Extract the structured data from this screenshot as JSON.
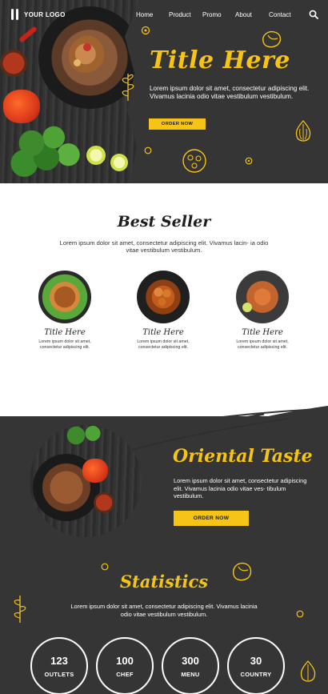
{
  "nav": {
    "logo_text": "YOUR LOGO",
    "items": [
      "Home",
      "Product",
      "Promo",
      "About",
      "Contact"
    ],
    "search_icon": "search-icon"
  },
  "hero": {
    "title": "Title Here",
    "body": "Lorem ipsum dolor sit amet, consectetur adipiscing elit. Vivamus lacinia odio vitae vestibulum vestibulum.",
    "button": "ORDER NOW"
  },
  "best_seller": {
    "title": "Best Seller",
    "body": "Lorem ipsum dolor sit amet, consectetur adipiscing elit. Vivamus lacin- ia odio vitae vestibulum vestibulum.",
    "dishes": [
      {
        "name": "Title Here",
        "desc": "Lorem ipsum dolor sit amet, consectetur adipiscing elit."
      },
      {
        "name": "Title Here",
        "desc": "Lorem ipsum dolor sit amet, consectetur adipiscing elit."
      },
      {
        "name": "Title Here",
        "desc": "Lorem ipsum dolor sit amet, consectetur adipiscing elit."
      }
    ]
  },
  "oriental": {
    "title": "Oriental Taste",
    "body": "Lorem ipsum dolor sit amet, consectetur adipiscing elit. Vivamus lacinia odio vitae ves- tibulum vestibulum.",
    "button": "ORDER NOW"
  },
  "statistics": {
    "title": "Statistics",
    "body": "Lorem ipsum dolor sit amet, consectetur adipiscing elit. Vivamus lacinia odio vitae vestibulum vestibulum.",
    "items": [
      {
        "value": "123",
        "label": "OUTLETS"
      },
      {
        "value": "100",
        "label": "CHEF"
      },
      {
        "value": "300",
        "label": "MENU"
      },
      {
        "value": "30",
        "label": "COUNTRY"
      }
    ]
  },
  "colors": {
    "accent": "#f6c416",
    "dark_bg": "#353535",
    "text_light": "#ffffff"
  }
}
